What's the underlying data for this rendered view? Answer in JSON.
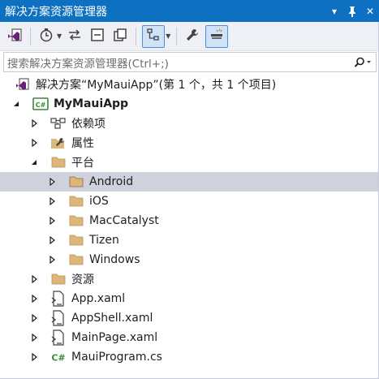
{
  "titlebar": {
    "title": "解决方案资源管理器",
    "dropdown_glyph": "▾",
    "pin_glyph": "ᛘ",
    "close_glyph": "✕"
  },
  "toolbar": {
    "icons": [
      "vs-solution-icon",
      "history-icon",
      "sync-icon",
      "collapse-all-icon",
      "copy-icon",
      "tree-view-icon",
      "wrench-icon",
      "preview-icon"
    ]
  },
  "search": {
    "placeholder": "搜索解决方案资源管理器(Ctrl+;)"
  },
  "tree": {
    "solution_label": "解决方案“MyMauiApp”(第 1 个，共 1 个项目)",
    "project_label": "MyMauiApp",
    "dependencies_label": "依赖项",
    "properties_label": "属性",
    "platforms_label": "平台",
    "platform_items": [
      "Android",
      "iOS",
      "MacCatalyst",
      "Tizen",
      "Windows"
    ],
    "resources_label": "资源",
    "files": [
      "App.xaml",
      "AppShell.xaml",
      "MainPage.xaml",
      "MauiProgram.cs"
    ],
    "selected_item": "Android"
  },
  "colors": {
    "titlebar_bg": "#0e70c0",
    "toolbar_bg": "#eef0f6",
    "selection_bg": "#cfd1dc",
    "folder": "#dcb67a",
    "csharp_green": "#388a34"
  }
}
